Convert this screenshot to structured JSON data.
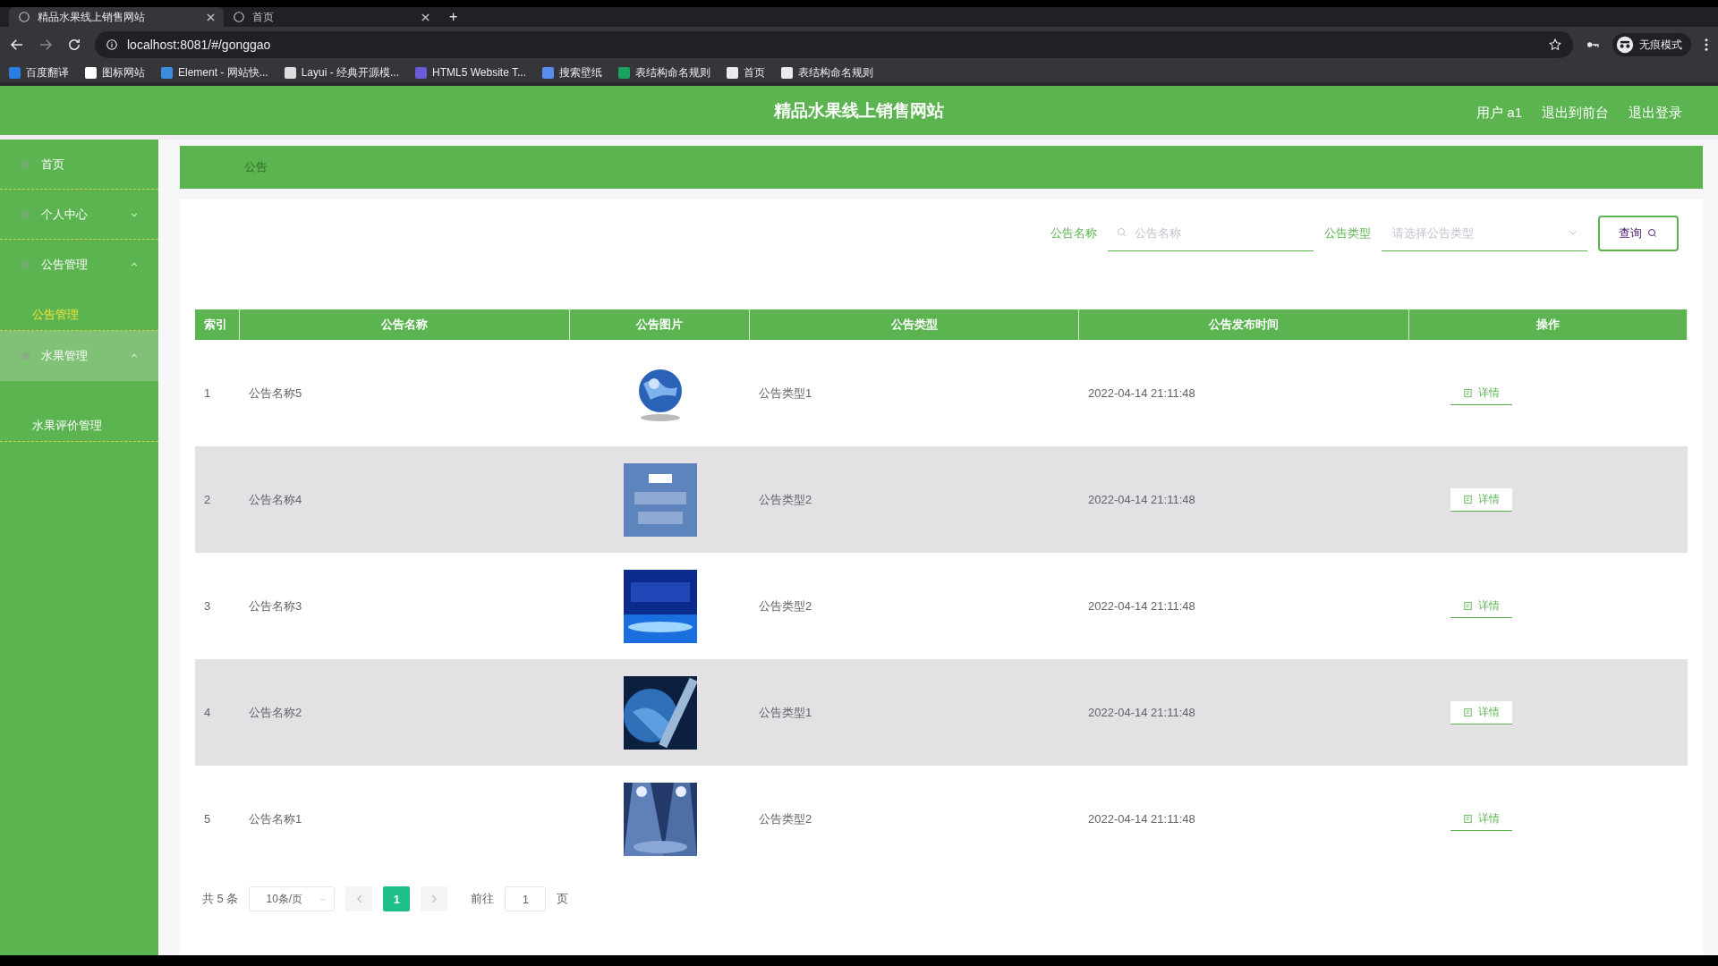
{
  "browser": {
    "tabs": [
      {
        "title": "精品水果线上销售网站",
        "selected": true
      },
      {
        "title": "首页",
        "selected": false
      }
    ],
    "new_tab": "+",
    "address": "localhost:8081/#/gonggao",
    "profile": "无痕模式",
    "bookmarks": [
      "百度翻译",
      "图标网站",
      "Element - 网站快...",
      "Layui - 经典开源模...",
      "HTML5 Website T...",
      "搜索壁纸",
      "表结构命名规则",
      "首页",
      "表结构命名规则"
    ]
  },
  "header": {
    "title": "精品水果线上销售网站",
    "links": [
      "用户 a1",
      "退出到前台",
      "退出登录"
    ]
  },
  "sidebar": {
    "items": [
      {
        "label": "首页",
        "highlighted": false
      },
      {
        "label": "个人中心",
        "expanded": false,
        "highlighted": false
      },
      {
        "label": "公告管理",
        "expanded": true,
        "highlighted": false,
        "children": [
          {
            "label": "公告管理",
            "selected": true
          }
        ]
      },
      {
        "label": "水果管理",
        "expanded": true,
        "highlighted": true,
        "children": [
          {
            "label": "水果评价管理",
            "selected": false
          }
        ]
      }
    ]
  },
  "breadcrumb": "公告",
  "search": {
    "name_label": "公告名称",
    "name_placeholder": "公告名称",
    "type_label": "公告类型",
    "type_placeholder": "请选择公告类型",
    "button": "查询"
  },
  "table": {
    "columns": [
      "索引",
      "公告名称",
      "公告图片",
      "公告类型",
      "公告发布时间",
      "操作"
    ],
    "rows": [
      {
        "index": "1",
        "name": "公告名称5",
        "type": "公告类型1",
        "time": "2022-04-14 21:11:48",
        "action": "详情"
      },
      {
        "index": "2",
        "name": "公告名称4",
        "type": "公告类型2",
        "time": "2022-04-14 21:11:48",
        "action": "详情"
      },
      {
        "index": "3",
        "name": "公告名称3",
        "type": "公告类型2",
        "time": "2022-04-14 21:11:48",
        "action": "详情"
      },
      {
        "index": "4",
        "name": "公告名称2",
        "type": "公告类型1",
        "time": "2022-04-14 21:11:48",
        "action": "详情"
      },
      {
        "index": "5",
        "name": "公告名称1",
        "type": "公告类型2",
        "time": "2022-04-14 21:11:48",
        "action": "详情"
      }
    ]
  },
  "pagination": {
    "total": "共 5 条",
    "page_size": "10条/页",
    "pages": [
      {
        "label": "1",
        "selected": true
      }
    ],
    "goto_label": "前往",
    "goto_value": "1",
    "goto_suffix": "页"
  }
}
